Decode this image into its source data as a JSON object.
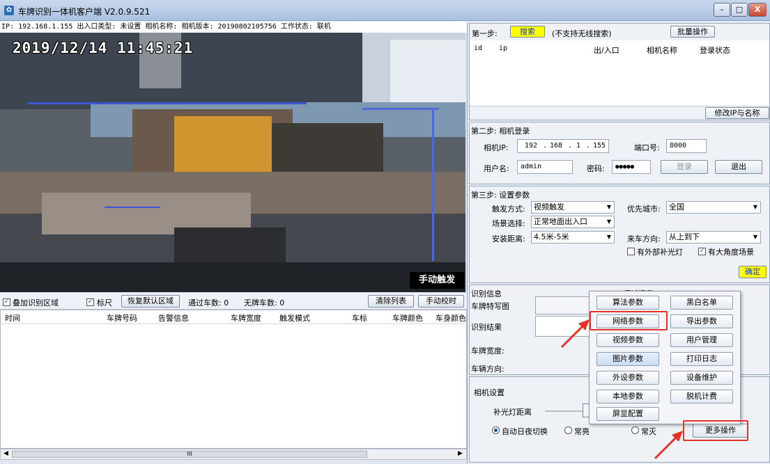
{
  "window": {
    "title": "车牌识别一体机客户端 V2.0.9.521",
    "min_label": "–",
    "max_label": "□",
    "close_label": "X"
  },
  "info_line": "IP: 192.168.1.155 出入口类型: 未设置 相机名称:  相机版本: 20190802105756 工作状态: 联机",
  "video": {
    "timestamp": "2019/12/14 11:45:21",
    "manual_trigger_overlay": "手动触发"
  },
  "controls": {
    "overlay_region_label": "叠加识别区域",
    "ruler_label": "标尺",
    "restore_region_button": "恢复默认区域",
    "passed_count_label": "通过车数: 0",
    "no_plate_count_label": "无牌车数: 0",
    "clear_list_button": "清除列表",
    "manual_calibrate_button": "手动校时"
  },
  "table": {
    "columns": [
      "时间",
      "车牌号码",
      "告警信息",
      "车牌宽度",
      "触发模式",
      "车标",
      "车牌颜色",
      "车身颜色"
    ]
  },
  "step1": {
    "label": "第一步:",
    "search_button": "搜索",
    "note": "(不支持无线搜索)",
    "batch_button": "批量操作",
    "columns": [
      "id",
      "ip",
      "出/入口",
      "相机名称",
      "登录状态"
    ],
    "modify_button": "修改IP与名称"
  },
  "step2": {
    "title": "第二步: 相机登录",
    "ip_label": "相机IP:",
    "ip_octets": [
      "192",
      "168",
      "1",
      "155"
    ],
    "port_label": "端口号:",
    "port_value": "8000",
    "user_label": "用户名:",
    "user_value": "admin",
    "pwd_label": "密码:",
    "pwd_value": "●●●●●",
    "login_button": "登录",
    "logout_button": "退出"
  },
  "step3": {
    "title": "第三步: 设置参数",
    "trigger_label": "触发方式:",
    "trigger_value": "视频触发",
    "city_label": "优先城市:",
    "city_value": "全国",
    "scene_label": "场景选择:",
    "scene_value": "正常地面出入口",
    "direction_label": "来车方向:",
    "direction_value": "从上到下",
    "distance_label": "安装距离:",
    "distance_value": "4.5米-5米",
    "external_light_label": "有外部补光灯",
    "wide_angle_label": "有大角度场景",
    "confirm_button": "确定"
  },
  "recognition": {
    "title": "识别信息",
    "debug_hint": "调试提示",
    "plate_image_label": "车牌特写图",
    "result_label": "识别结果",
    "plate_width_label": "车牌宽度:",
    "vehicle_direction_label": "车辆方向:"
  },
  "camera_settings": {
    "title": "相机设置",
    "fill_light_label": "补光灯距离",
    "auto_daynight_label": "自动日夜切换",
    "always_on_label": "常亮",
    "always_off_label": "常灭",
    "more_ops_button": "更多操作"
  },
  "popup_menu": {
    "left": [
      "算法参数",
      "网络参数",
      "视频参数",
      "图片参数",
      "外设参数",
      "本地参数",
      "屏显配置"
    ],
    "right": [
      "黑白名单",
      "导出参数",
      "用户管理",
      "打印日志",
      "设备维护",
      "脱机计费"
    ]
  },
  "scrollbar": {
    "thumb_label": "III"
  },
  "colors": {
    "highlight_red": "#e53128",
    "search_button_yellow": "#ffff00",
    "confirm_button_yellow": "#ffff00"
  }
}
